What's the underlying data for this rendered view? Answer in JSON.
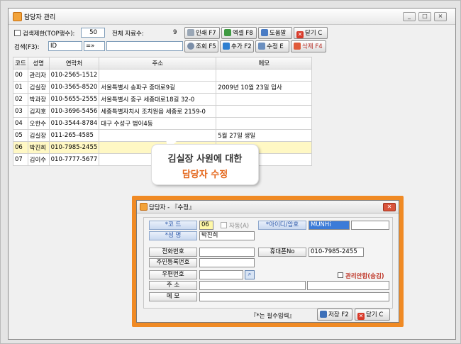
{
  "window": {
    "title": "담당자 관리",
    "btn_min": "_",
    "btn_max": "□",
    "btn_close": "×"
  },
  "toolbar1": {
    "limit_label": "검색제한(TOP행수):",
    "limit_value": "50",
    "total_label": "전체 자료수:",
    "total_value": "9",
    "print": "인쇄 F7",
    "excel": "엑셀 F8",
    "help": "도움말",
    "close": "닫기 C"
  },
  "toolbar2": {
    "search_label": "검색(F3):",
    "field_value": "ID",
    "op_value": "=»",
    "query": "조회 F5",
    "add": "추가 F2",
    "edit": "수정 E",
    "delete": "삭제 F4"
  },
  "grid": {
    "headers": [
      "코드",
      "성명",
      "연락처",
      "주소",
      "메모"
    ],
    "rows": [
      [
        "00",
        "관리자",
        "010-2565-1512",
        "",
        ""
      ],
      [
        "01",
        "김실장",
        "010-3565-8520",
        "서울특별시 송파구 중대로9길",
        "2009년 10월 23일 입사"
      ],
      [
        "02",
        "박과장",
        "010-5655-2555",
        "서울특별시 중구 세종대로18길 32-0",
        ""
      ],
      [
        "03",
        "김지호",
        "010-3696-5456",
        "세종특별자치시  조치원읍 세종로 2159-0",
        ""
      ],
      [
        "04",
        "오한수",
        "010-3544-8784",
        "대구 수성구 범어4동",
        ""
      ],
      [
        "05",
        "김실장",
        "011-265-4585",
        "",
        "5월 27일 생일"
      ],
      [
        "06",
        "박진희",
        "010-7985-2455",
        "",
        ""
      ],
      [
        "07",
        "김이수",
        "010-7777-5677",
        "",
        ""
      ]
    ],
    "selected_index": 6
  },
  "callout": {
    "line1": "김실장 사원에 대한",
    "line2": "담당자 수정"
  },
  "dialog": {
    "title": "담당자 - 『수정』",
    "code_label": "*코    드",
    "code_value": "06",
    "auto_label": "자동(A)",
    "id_label": "*아이디/암호",
    "id_value": "MUNHi",
    "name_label": "*성    명",
    "name_value": "박진희",
    "phone_label": "전화번호",
    "mobile_label": "휴대폰No",
    "mobile_value": "010-7985-2455",
    "rrn_label": "주민등록번호",
    "zip_label": "우편번호",
    "admin_label": "관리안함(숨김)",
    "addr_label": "주    소",
    "memo_label": "메    모",
    "required_note": "『*는 필수입력』",
    "save": "저장 F2",
    "close": "닫기 C"
  },
  "colors": {
    "accent": "#f08a24",
    "selected_row": "#fff8c4",
    "required_label": "#2b57a8",
    "admin_label": "#c0392b"
  }
}
